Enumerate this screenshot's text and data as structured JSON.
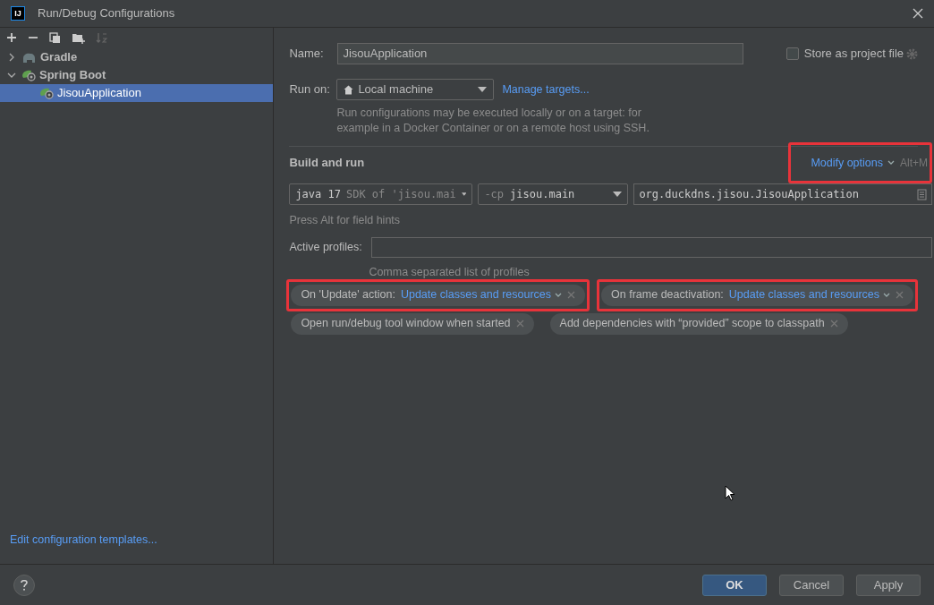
{
  "window": {
    "title": "Run/Debug Configurations",
    "logo": "IJ"
  },
  "tree": [
    {
      "label": "Gradle",
      "kind": "gradle",
      "expanded": false,
      "selected": false
    },
    {
      "label": "Spring Boot",
      "kind": "spring",
      "expanded": true,
      "selected": false,
      "children": [
        {
          "label": "JisouApplication",
          "kind": "spring",
          "selected": true
        }
      ]
    }
  ],
  "templates_link": "Edit configuration templates...",
  "form": {
    "name_label": "Name:",
    "name_value": "JisouApplication",
    "store_label": "Store as project file",
    "store_checked": false,
    "run_on_label": "Run on:",
    "run_on_value": "Local machine",
    "manage_link": "Manage targets...",
    "run_on_hint": "Run configurations may be executed locally or on a target: for example in a Docker Container or on a remote host using SSH.",
    "section": "Build and run",
    "modify": {
      "label": "Modify options",
      "shortcut": "Alt+M",
      "highlighted": true
    },
    "sdk": {
      "main": "java 17",
      "hint": "SDK of 'jisou.mai"
    },
    "cp": {
      "prefix": "-cp",
      "value": "jisou.main"
    },
    "main_class": "org.duckdns.jisou.JisouApplication",
    "field_hint": "Press Alt for field hints",
    "profiles_label": "Active profiles:",
    "profiles_hint": "Comma separated list of profiles",
    "chips": [
      [
        {
          "label": "On 'Update' action:",
          "value": "Update classes and resources",
          "highlighted": true
        },
        {
          "label": "On frame deactivation:",
          "value": "Update classes and resources",
          "highlighted": true
        }
      ],
      [
        {
          "label": "Open run/debug tool window when started",
          "highlighted": false
        },
        {
          "label": "Add dependencies with “provided” scope to classpath",
          "highlighted": false
        }
      ]
    ]
  },
  "buttons": [
    {
      "label": "OK",
      "kind": "primary"
    },
    {
      "label": "Cancel",
      "kind": "normal"
    },
    {
      "label": "Apply",
      "kind": "normal"
    }
  ]
}
